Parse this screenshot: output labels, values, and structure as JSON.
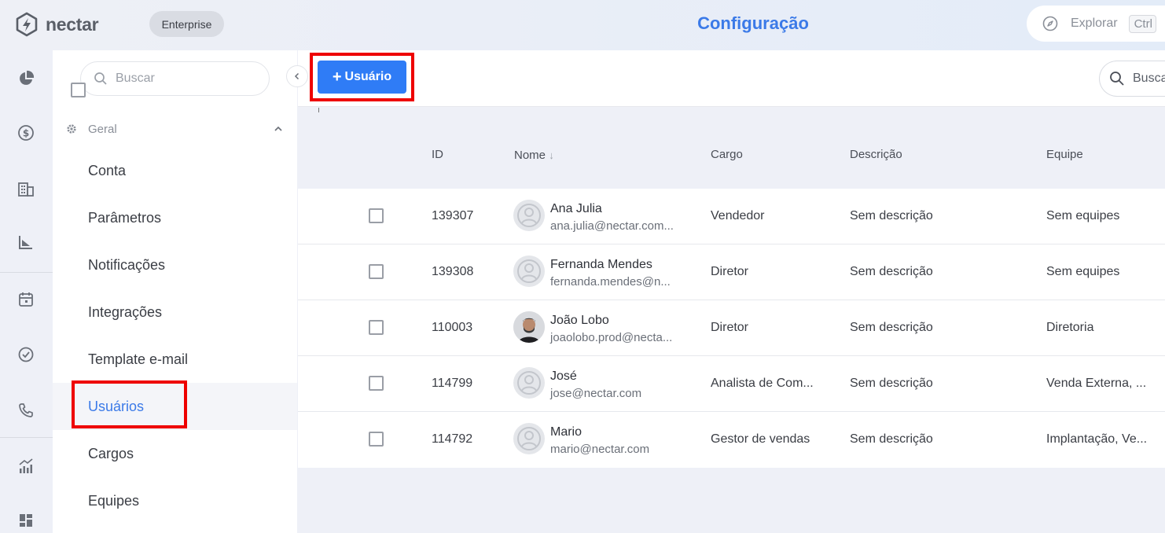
{
  "header": {
    "app_name": "nectar",
    "plan_badge": "Enterprise",
    "page_title": "Configuração",
    "explore_label": "Explorar",
    "shortcut": "Ctrl"
  },
  "rail": {
    "icons": [
      "pie-chart-icon",
      "dollar-icon",
      "building-icon",
      "funnel-chart-icon",
      "calendar-icon",
      "check-circle-icon",
      "phone-icon",
      "trend-chart-icon",
      "dashboard-icon"
    ]
  },
  "sidebar": {
    "search_placeholder": "Buscar",
    "group_label": "Geral",
    "items": [
      {
        "label": "Conta"
      },
      {
        "label": "Parâmetros"
      },
      {
        "label": "Notificações"
      },
      {
        "label": "Integrações"
      },
      {
        "label": "Template e-mail"
      },
      {
        "label": "Usuários",
        "active": true
      },
      {
        "label": "Cargos"
      },
      {
        "label": "Equipes"
      }
    ]
  },
  "toolbar": {
    "add_user_label": "Usuário",
    "search_placeholder": "Buscar"
  },
  "table": {
    "columns": [
      "ID",
      "Nome",
      "Cargo",
      "Descrição",
      "Equipe"
    ],
    "rows": [
      {
        "id": "139307",
        "name": "Ana Julia",
        "email": "ana.julia@nectar.com...",
        "cargo": "Vendedor",
        "descricao": "Sem descrição",
        "equipe": "Sem equipes",
        "avatar": "placeholder"
      },
      {
        "id": "139308",
        "name": "Fernanda Mendes",
        "email": "fernanda.mendes@n...",
        "cargo": "Diretor",
        "descricao": "Sem descrição",
        "equipe": "Sem equipes",
        "avatar": "placeholder"
      },
      {
        "id": "110003",
        "name": "João Lobo",
        "email": "joaolobo.prod@necta...",
        "cargo": "Diretor",
        "descricao": "Sem descrição",
        "equipe": "Diretoria",
        "avatar": "photo"
      },
      {
        "id": "114799",
        "name": "José",
        "email": "jose@nectar.com",
        "cargo": "Analista de Com...",
        "descricao": "Sem descrição",
        "equipe": "Venda Externa, ...",
        "avatar": "placeholder"
      },
      {
        "id": "114792",
        "name": "Mario",
        "email": "mario@nectar.com",
        "cargo": "Gestor de vendas",
        "descricao": "Sem descrição",
        "equipe": "Implantação, Ve...",
        "avatar": "placeholder"
      }
    ]
  },
  "colors": {
    "accent": "#2f7cf6",
    "title": "#3b7ae8",
    "highlight": "#ee0000"
  }
}
